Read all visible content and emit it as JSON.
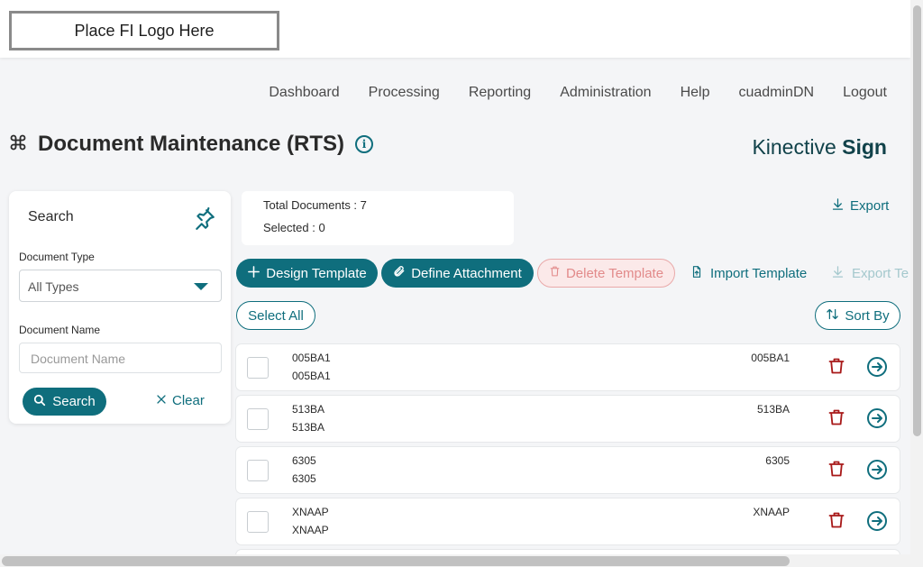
{
  "header": {
    "logo_text": "Place FI Logo Here"
  },
  "nav": {
    "items": [
      "Dashboard",
      "Processing",
      "Reporting",
      "Administration",
      "Help",
      "cuadminDN",
      "Logout"
    ]
  },
  "page": {
    "title": "Document Maintenance (RTS)",
    "info_glyph": "i"
  },
  "brand": {
    "part1": "Kinective ",
    "part2": "Sign"
  },
  "search": {
    "title": "Search",
    "doc_type_label": "Document Type",
    "doc_type_value": "All Types",
    "doc_name_label": "Document Name",
    "doc_name_placeholder": "Document Name",
    "search_label": "Search",
    "clear_label": "Clear"
  },
  "summary": {
    "total_label": "Total Documents : ",
    "total_value": "7",
    "selected_label": "Selected : ",
    "selected_value": "0"
  },
  "actions": {
    "export_label": "Export",
    "design_template_label": "Design Template",
    "define_attachment_label": "Define Attachment",
    "delete_template_label": "Delete Template",
    "import_template_label": "Import Template",
    "export_template_label": "Export Te",
    "select_all_label": "Select All",
    "sort_by_label": "Sort By"
  },
  "documents": [
    {
      "name": "005BA1",
      "description": "005BA1",
      "code": "005BA1"
    },
    {
      "name": "513BA",
      "description": "513BA",
      "code": "513BA"
    },
    {
      "name": "6305",
      "description": "6305",
      "code": "6305"
    },
    {
      "name": "XNAAP",
      "description": "XNAAP",
      "code": "XNAAP"
    }
  ],
  "colors": {
    "accent": "#0f6e7d",
    "danger": "#a81919"
  }
}
